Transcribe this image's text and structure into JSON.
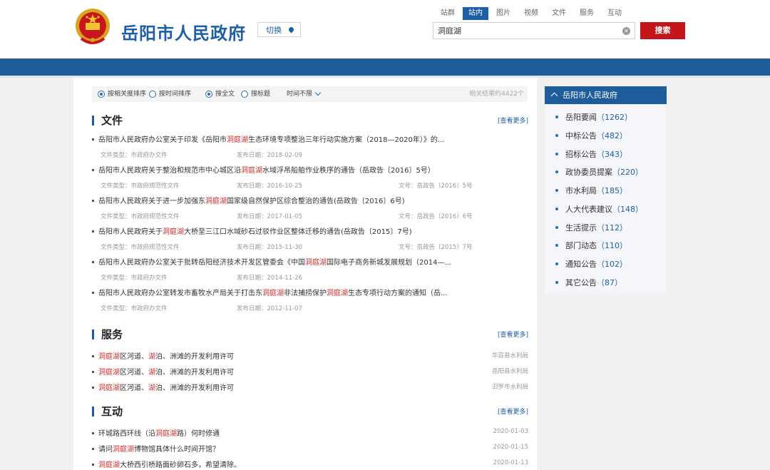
{
  "header": {
    "site_title": "岳阳市人民政府",
    "switch_label": "切换",
    "scope_tabs": [
      {
        "label": "站群",
        "active": false
      },
      {
        "label": "站内",
        "active": true
      },
      {
        "label": "图片",
        "active": false
      },
      {
        "label": "视频",
        "active": false
      },
      {
        "label": "文件",
        "active": false
      },
      {
        "label": "服务",
        "active": false
      },
      {
        "label": "互动",
        "active": false
      }
    ],
    "search_value": "洞庭湖",
    "search_button": "搜索",
    "colors": {
      "brand_blue": "#1d5ea6",
      "band_blue": "#1e5c9c",
      "search_red": "#c4141a",
      "highlight": "#d32f2f"
    }
  },
  "filters": {
    "sort_relevance": "按相关度排序",
    "sort_time": "按时间排序",
    "scope_full": "搜全文",
    "scope_title": "搜标题",
    "time_range": "时间不限",
    "result_count": "相关结果约4422个"
  },
  "sections": {
    "files": {
      "title": "文件",
      "more": "[查看更多]",
      "items": [
        {
          "t1": "岳阳市人民政府办公室关于印发《岳阳市",
          "h1": "洞庭湖",
          "t2": "生态环境专项整治三年行动实施方案（2018—2020年）》的...",
          "h2": "",
          "t3": "",
          "type": "文件类型：市政府办文件",
          "date": "发布日期：2018-02-09",
          "doc_no": ""
        },
        {
          "t1": "岳阳市人民政府关于整治和规范市中心城区沿",
          "h1": "洞庭湖",
          "t2": "水域浮吊船舶作业秩序的通告（岳政告〔2016〕5号）",
          "h2": "",
          "t3": "",
          "type": "文件类型：市政府规范性文件",
          "date": "发布日期：2016-10-25",
          "doc_no": "文号：岳政告〔2016〕5号"
        },
        {
          "t1": "岳阳市人民政府关于进一步加强东",
          "h1": "洞庭湖",
          "t2": "国家级自然保护区综合整治的通告(岳政告〔2016〕6号)",
          "h2": "",
          "t3": "",
          "type": "文件类型：市政府规范性文件",
          "date": "发布日期：2017-01-05",
          "doc_no": "文号：岳政告〔2016〕6号"
        },
        {
          "t1": "岳阳市人民政府关于",
          "h1": "洞庭湖",
          "t2": "大桥至三江口水域砂石过驳作业区整体迁移的通告(岳政告〔2015〕7号)",
          "h2": "",
          "t3": "",
          "type": "文件类型：市政府规范性文件",
          "date": "发布日期：2015-11-30",
          "doc_no": "文号：岳政告〔2015〕7号"
        },
        {
          "t1": "岳阳市人民政府办公室关于批转岳阳经济技术开发区管委会《中国",
          "h1": "洞庭湖",
          "t2": "国际电子商务新城发展规划（2014—...",
          "h2": "",
          "t3": "",
          "type": "文件类型：市政府办文件",
          "date": "发布日期：2014-11-26",
          "doc_no": ""
        },
        {
          "t1": "岳阳市人民政府办公室转发市畜牧水产局关于打击东",
          "h1": "洞庭湖",
          "t2": "非法捕捞保护",
          "h2": "洞庭湖",
          "t3": "生态专项行动方案的通知（岳...",
          "type": "文件类型：市政府办文件",
          "date": "发布日期：2012-11-07",
          "doc_no": ""
        }
      ]
    },
    "services": {
      "title": "服务",
      "more": "[查看更多]",
      "items": [
        {
          "h1": "洞庭湖",
          "t1": "区河道、",
          "h2": "湖",
          "t2": "泊、洲滩的开发利用许可",
          "org": "华容县水利局"
        },
        {
          "h1": "洞庭湖",
          "t1": "区河道、",
          "h2": "湖",
          "t2": "泊、洲滩的开发利用许可",
          "org": "岳阳县水利局"
        },
        {
          "h1": "洞庭湖",
          "t1": "区河道、",
          "h2": "湖",
          "t2": "泊、洲滩的开发利用许可",
          "org": "汨罗市水利局"
        }
      ]
    },
    "interaction": {
      "title": "互动",
      "more": "[查看更多]",
      "items": [
        {
          "t1": "环城路西环线（沿",
          "h1": "洞庭湖",
          "t2": "路）何时修通",
          "date": "2020-01-03"
        },
        {
          "t1": "请问",
          "h1": "洞庭湖",
          "t2": "博物馆具体什么时间开馆？",
          "date": "2020-01-15"
        },
        {
          "t1": "",
          "h1": "洞庭湖",
          "t2": "大桥西引桥路面砂卵石多，希望清除。",
          "date": "2020-01-13"
        }
      ]
    }
  },
  "sidebar": {
    "title": "岳阳市人民政府",
    "items": [
      {
        "label": "岳阳要闻",
        "count": "（1262）"
      },
      {
        "label": "中标公告",
        "count": "（482）"
      },
      {
        "label": "招标公告",
        "count": "（343）"
      },
      {
        "label": "政协委员提案",
        "count": "（220）"
      },
      {
        "label": "市水利局",
        "count": "（185）"
      },
      {
        "label": "人大代表建议",
        "count": "（148）"
      },
      {
        "label": "生活提示",
        "count": "（112）"
      },
      {
        "label": "部门动态",
        "count": "（110）"
      },
      {
        "label": "通知公告",
        "count": "（102）"
      },
      {
        "label": "其它公告",
        "count": "（87）"
      }
    ]
  }
}
